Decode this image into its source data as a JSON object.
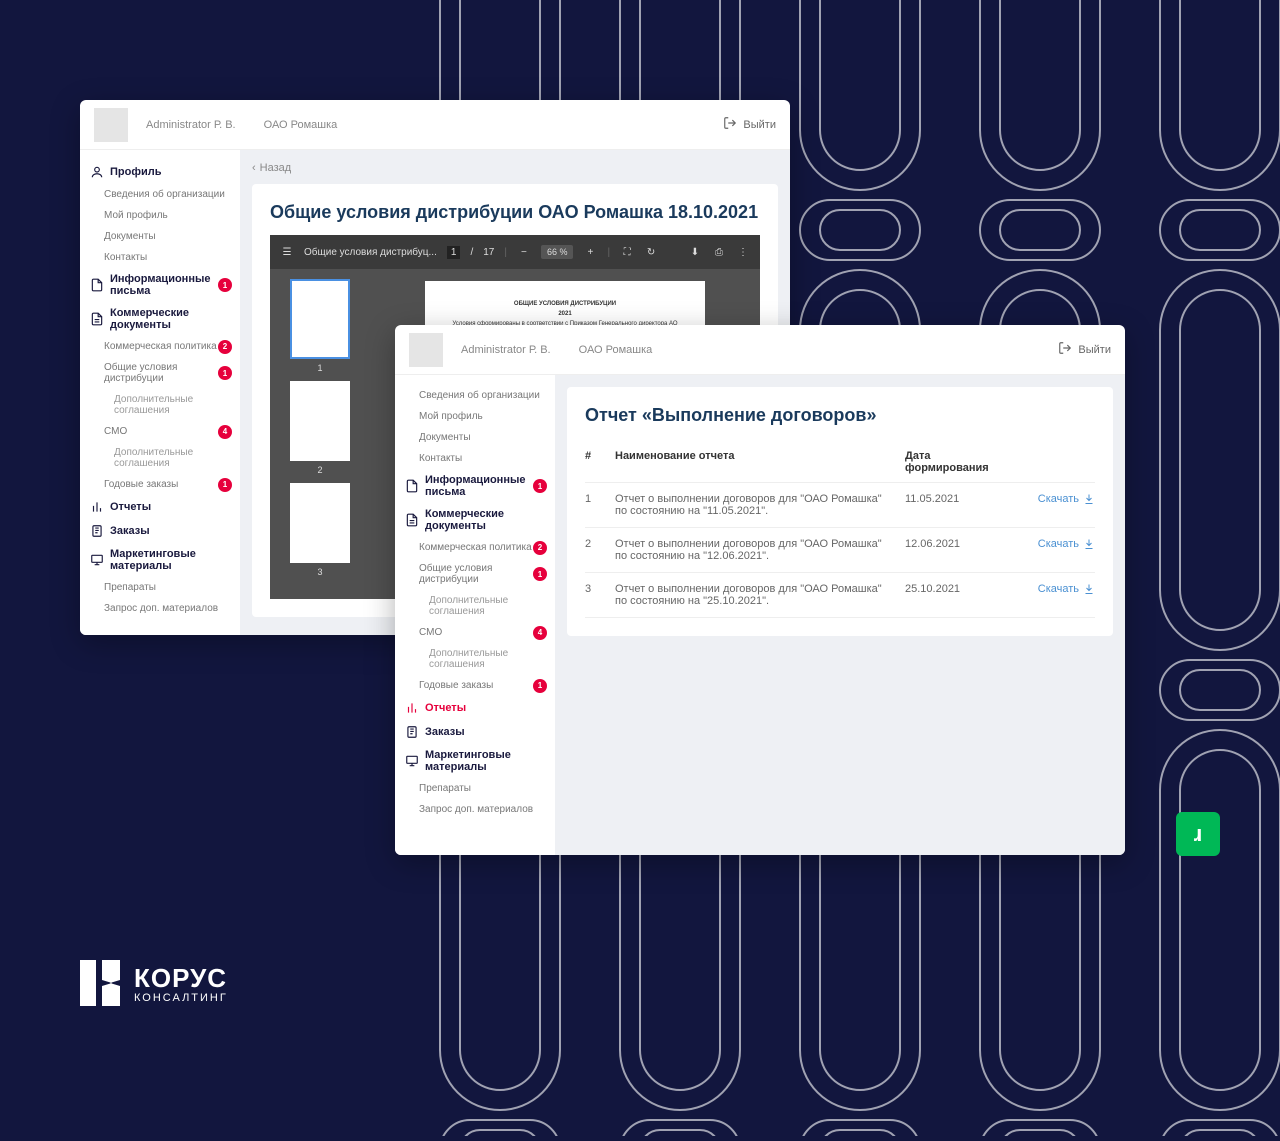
{
  "brand": {
    "name": "КОРУС",
    "sub": "КОНСАЛТИНГ"
  },
  "topbar": {
    "user": "Administrator Р. В.",
    "org": "ОАО Ромашка",
    "logout": "Выйти"
  },
  "nav": {
    "profile": "Профиль",
    "orgInfo": "Сведения об организации",
    "myProfile": "Мой профиль",
    "documents": "Документы",
    "contacts": "Контакты",
    "infoLetters": "Информационные письма",
    "commDocs": "Коммерческие документы",
    "commPolicy": "Коммерческая политика",
    "genConditions": "Общие условия дистрибуции",
    "addAgreements": "Дополнительные соглашения",
    "smo": "СМО",
    "yearlyOrders": "Годовые заказы",
    "reports": "Отчеты",
    "orders": "Заказы",
    "marketing": "Маркетинговые материалы",
    "preparations": "Препараты",
    "requestMaterials": "Запрос доп. материалов",
    "badges": {
      "infoLetters": "1",
      "commPolicy": "2",
      "genConditions": "1",
      "smo": "4",
      "yearlyOrders": "1"
    }
  },
  "windowA": {
    "back": "Назад",
    "title": "Общие условия дистрибуции ОАО Ромашка 18.10.2021",
    "pdf": {
      "filename": "Общие условия дистрибуц...",
      "page": "1",
      "total": "17",
      "zoom": "66 %",
      "docHeading": "ОБЩИЕ УСЛОВИЯ ДИСТРИБУЦИИ",
      "docYear": "2021",
      "docSub": "Условия сформированы в соответствии с Приказом Генерального директора АО «БАЙЕР»"
    }
  },
  "windowB": {
    "title": "Отчет «Выполнение договоров»",
    "cols": {
      "num": "#",
      "name": "Наименование отчета",
      "date": "Дата формирования"
    },
    "download": "Скачать",
    "rows": [
      {
        "n": "1",
        "name": "Отчет о выполнении договоров для \"ОАО Ромашка\" по состоянию на \"11.05.2021\".",
        "date": "11.05.2021"
      },
      {
        "n": "2",
        "name": "Отчет о выполнении договоров для \"ОАО Ромашка\" по состоянию на \"12.06.2021\".",
        "date": "12.06.2021"
      },
      {
        "n": "3",
        "name": "Отчет о выполнении договоров для \"ОАО Ромашка\" по состоянию на \"25.10.2021\".",
        "date": "25.10.2021"
      }
    ]
  }
}
